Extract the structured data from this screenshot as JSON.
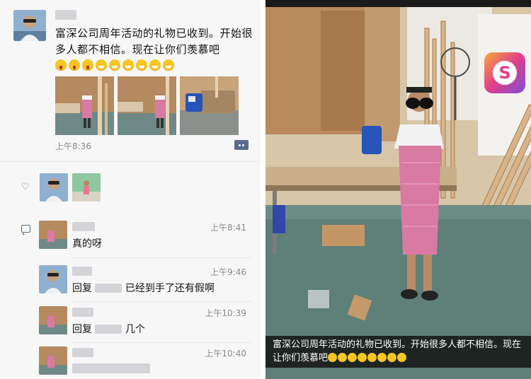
{
  "post": {
    "author_name": "",
    "text": "富深公司周年活动的礼物已收到。开始很多人都不相信。现在让你们羡慕吧",
    "emojis": [
      "tongue",
      "tongue",
      "tongue",
      "grin",
      "grin",
      "grin",
      "grin",
      "grin",
      "grin"
    ],
    "time": "上午8:36",
    "photo_count": 3
  },
  "likes": {
    "count": 2
  },
  "comments": [
    {
      "time": "上午8:41",
      "text": "真的呀"
    },
    {
      "time": "上午9:46",
      "reply_prefix": "回复",
      "text": "已经到手了还有假啊"
    },
    {
      "time": "上午10:39",
      "reply_prefix": "回复",
      "text": "几个"
    },
    {
      "time": "上午10:40",
      "text": ""
    }
  ],
  "photo": {
    "caption": "富深公司周年活动的礼物已收到。开始很多人都不相信。现在让你们羡慕吧",
    "caption_emojis": [
      "tongue",
      "tongue",
      "tongue",
      "grin",
      "grin",
      "grin",
      "grin",
      "grin"
    ],
    "app_icon": "S",
    "icon_name": "retouch-app-icon"
  },
  "colors": {
    "link_blue": "#5b6b8c",
    "emoji_yellow": "#f6c624",
    "apron_pink": "#d97aa3"
  }
}
